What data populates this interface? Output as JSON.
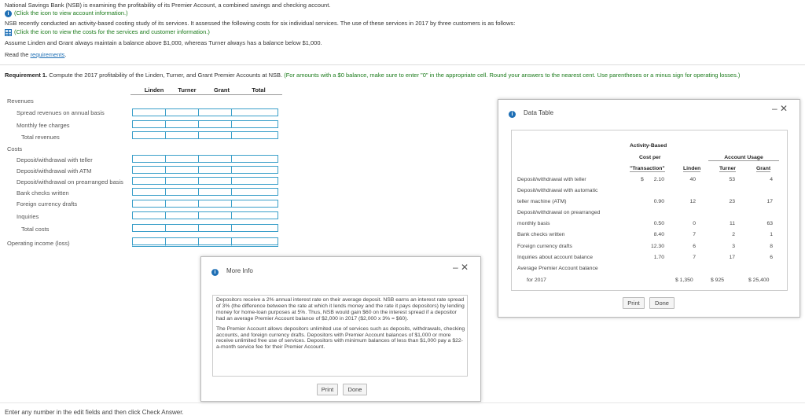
{
  "intro": {
    "line1": "National Savings Bank (NSB) is examining the profitability of its Premier Account, a combined savings and checking account.",
    "link1": "(Click the icon to view account information.)",
    "line2": "NSB recently conducted an activity-based costing study of its services. It assessed the following costs for six individual services. The use of these services in 2017 by three customers is as follows:",
    "link2": "(Click the icon to view the costs for the services and customer information.)",
    "line3": "Assume Linden and Grant always maintain a balance above $1,000, whereas Turner always has a balance below $1,000.",
    "read_prefix": "Read the ",
    "read_link": "requirements",
    "read_suffix": "."
  },
  "requirement": {
    "label": "Requirement 1.",
    "text": " Compute the 2017 profitability of the Linden, Turner, and Grant Premier Accounts at NSB.",
    "note": " (For amounts with a $0 balance, make sure to enter \"0\" in the appropriate cell. Round your answers to the nearest cent. Use parentheses or a minus sign for operating losses.)"
  },
  "table": {
    "columns": [
      "Linden",
      "Turner",
      "Grant",
      "Total"
    ],
    "revenues_label": "Revenues",
    "costs_label": "Costs",
    "rows": {
      "spread": "Spread revenues on annual basis",
      "monthly_fee": "Monthly fee charges",
      "total_revenues": "Total revenues",
      "teller": "Deposit/withdrawal with teller",
      "atm": "Deposit/withdrawal with ATM",
      "prearranged": "Deposit/withdrawal on prearranged basis",
      "checks": "Bank checks written",
      "foreign": "Foreign currency drafts",
      "inquiries": "Inquiries",
      "total_costs": "Total costs",
      "operating_income": "Operating income (loss)"
    }
  },
  "footer": "Enter any number in the edit fields and then click Check Answer.",
  "more_info": {
    "title": "More Info",
    "close": "– ✕",
    "para1": "Depositors receive a 2% annual interest rate on their average deposit. NSB earns an interest rate spread of 3% (the difference between the rate at which it lends money and the rate it pays depositors) by lending money for home-loan purposes at 5%. Thus, NSB would gain $60 on the interest spread if a depositor had an average Premier Account balance of $2,000 in 2017 ($2,000 x 3% = $60).",
    "para2": "The Premier Account allows depositors unlimited use of services such as deposits, withdrawals, checking accounts, and foreign currency drafts. Depositors with Premier Account balances of $1,000 or more receive unlimited free use of services. Depositors with minimum balances of less than $1,000 pay a $22-a-month service fee for their Premier Account.",
    "print": "Print",
    "done": "Done"
  },
  "data_table": {
    "title": "Data Table",
    "close": "– ✕",
    "hdr_abc1": "Activity-Based",
    "hdr_abc2": "Cost per",
    "hdr_abc3": "\"Transaction\"",
    "hdr_usage": "Account Usage",
    "hdr_linden": "Linden",
    "hdr_turner": "Turner",
    "hdr_grant": "Grant",
    "rows": [
      {
        "label": "Deposit/withdrawal with teller",
        "dollar": "$",
        "cost": "2.10",
        "linden": "40",
        "turner": "53",
        "grant": "4"
      },
      {
        "label": "Deposit/withdrawal with automatic",
        "dollar": "",
        "cost": "",
        "linden": "",
        "turner": "",
        "grant": ""
      },
      {
        "label": "teller machine (ATM)",
        "dollar": "",
        "cost": "0.90",
        "linden": "12",
        "turner": "23",
        "grant": "17"
      },
      {
        "label": "Deposit/withdrawal on prearranged",
        "dollar": "",
        "cost": "",
        "linden": "",
        "turner": "",
        "grant": ""
      },
      {
        "label": "monthly basis",
        "dollar": "",
        "cost": "0.50",
        "linden": "0",
        "turner": "11",
        "grant": "63"
      },
      {
        "label": "Bank checks written",
        "dollar": "",
        "cost": "8.40",
        "linden": "7",
        "turner": "2",
        "grant": "1"
      },
      {
        "label": "Foreign currency drafts",
        "dollar": "",
        "cost": "12.30",
        "linden": "6",
        "turner": "3",
        "grant": "8"
      },
      {
        "label": "Inquiries about account balance",
        "dollar": "",
        "cost": "1.70",
        "linden": "7",
        "turner": "17",
        "grant": "6"
      },
      {
        "label": "Average Premier Account balance",
        "dollar": "",
        "cost": "",
        "linden": "",
        "turner": "",
        "grant": ""
      }
    ],
    "last_row_label": "for 2017",
    "bal_linden": "$    1,350",
    "bal_turner": "$     925",
    "bal_grant": "$  25,400",
    "print": "Print",
    "done": "Done"
  }
}
